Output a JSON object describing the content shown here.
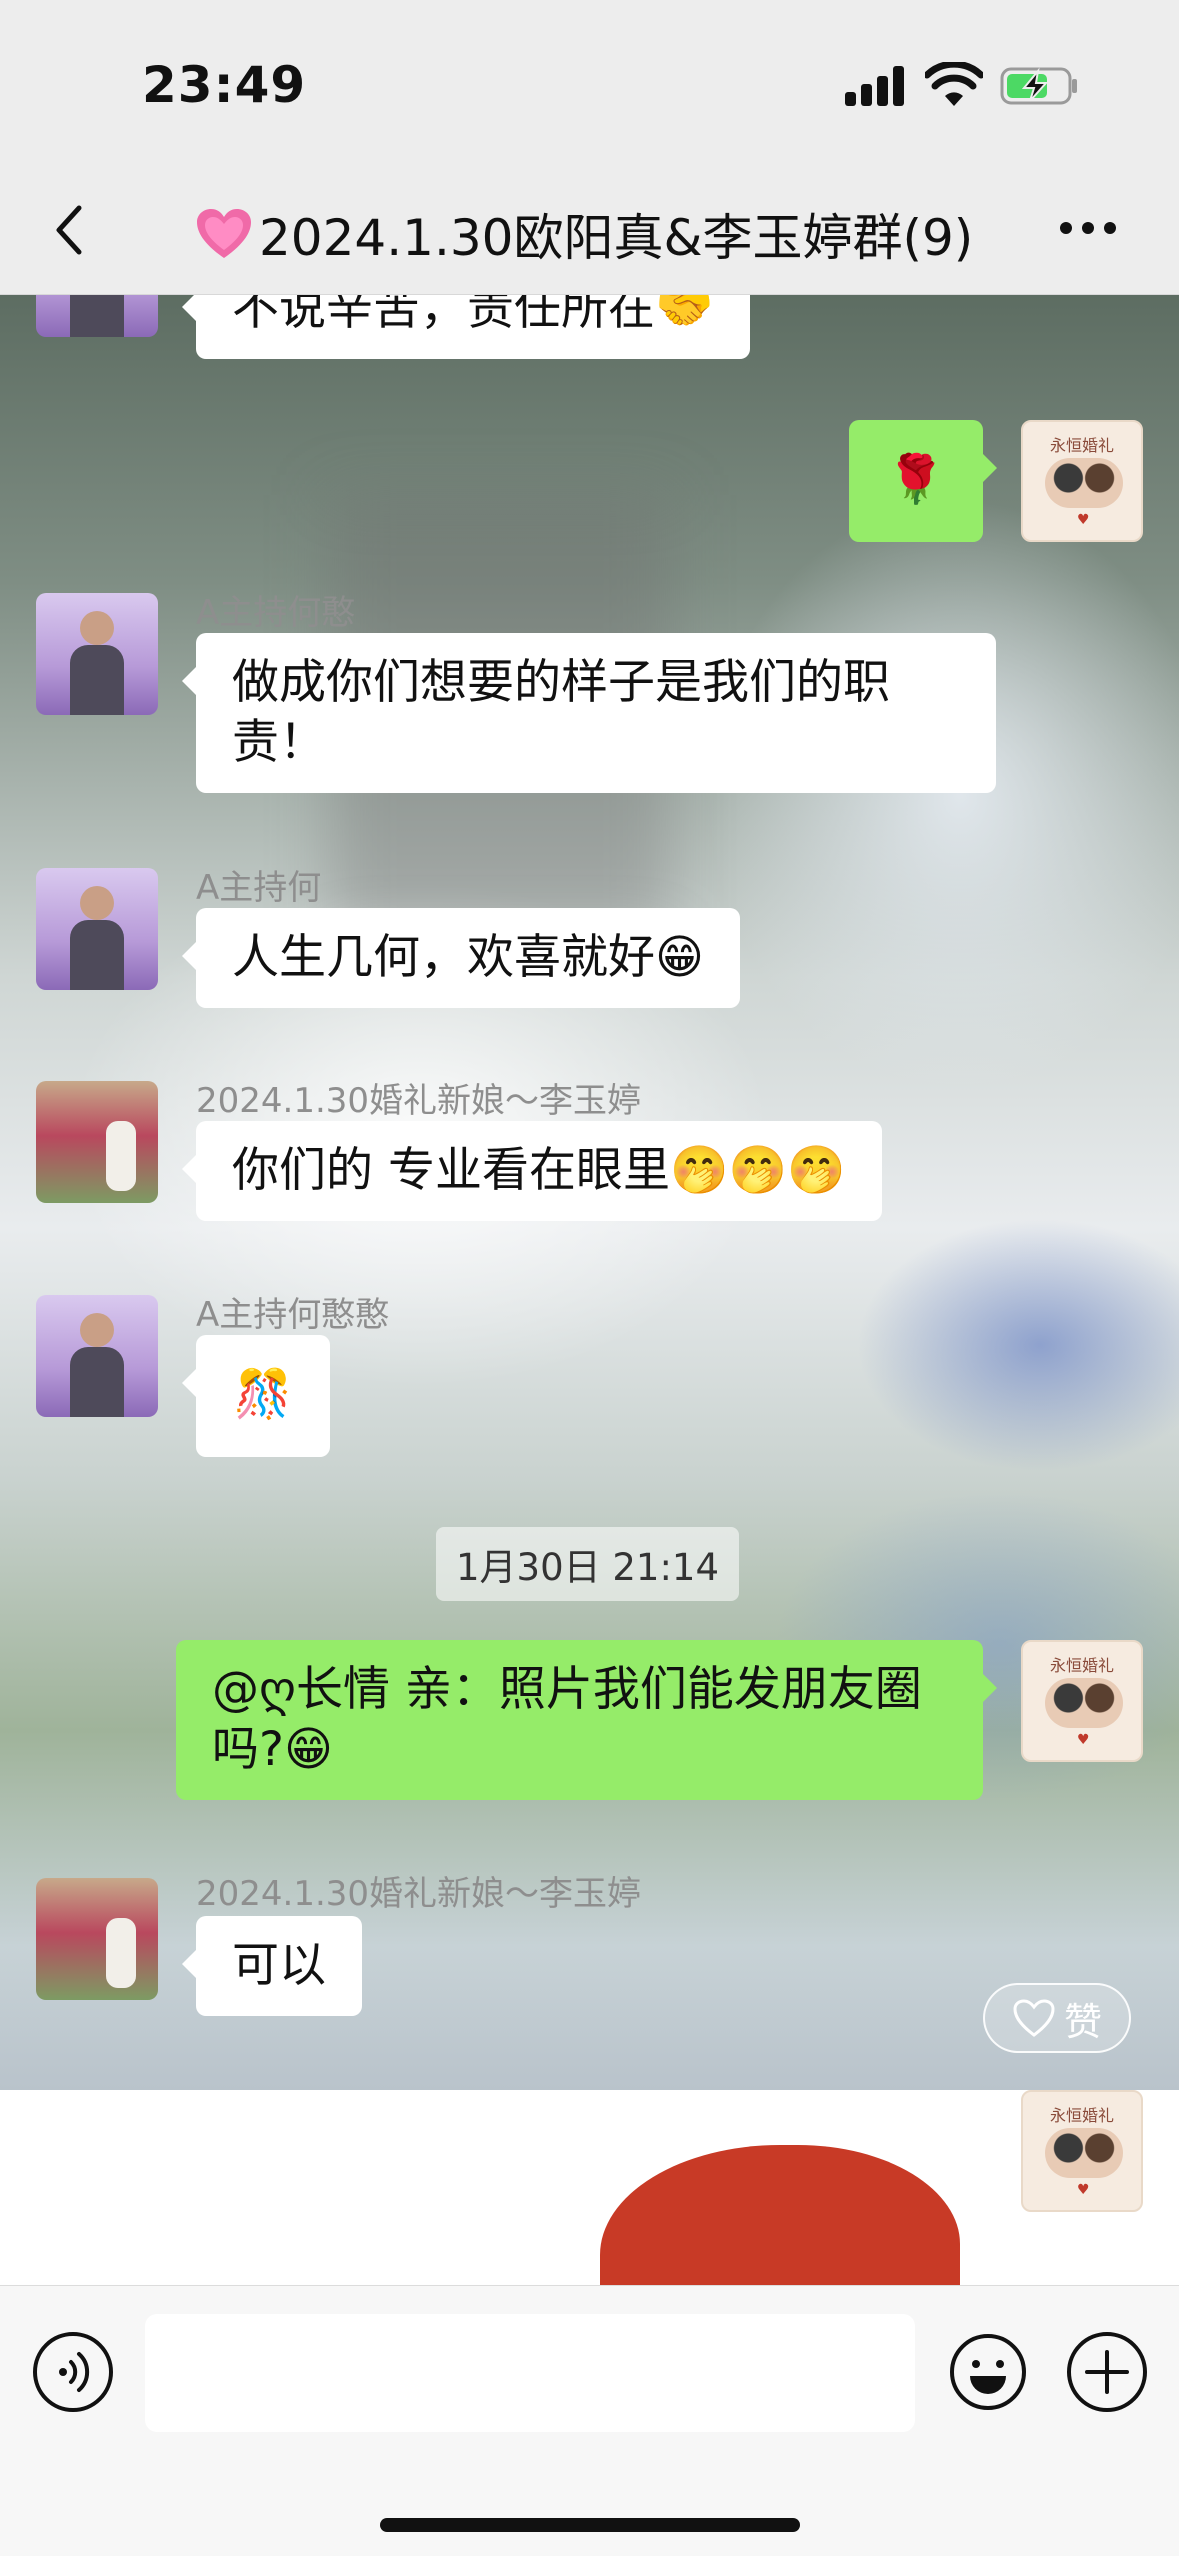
{
  "status_bar": {
    "time": "23:49"
  },
  "header": {
    "title": "2024.1.30欧阳真&李玉婷群(9)"
  },
  "messages": [
    {
      "text": "不说辛苦，责任所在🤝"
    },
    {
      "text": "🌹"
    },
    {
      "sender": "A主持何憨",
      "text": "做成你们想要的样子是我们的职责！"
    },
    {
      "sender": "A主持何",
      "text": "人生几何，欢喜就好😁"
    },
    {
      "sender": "2024.1.30婚礼新娘～李玉婷",
      "text": "你们的 专业看在眼里🤭🤭🤭"
    },
    {
      "sender": "A主持何憨憨",
      "text": "🎊"
    },
    {
      "timestamp": "1月30日 21:14"
    },
    {
      "text": "@ღ长情 亲：照片我们能发朋友圈吗?😁"
    },
    {
      "sender": "2024.1.30婚礼新娘～李玉婷",
      "text": "可以"
    }
  ],
  "like_button": {
    "label": "赞"
  },
  "input_bar": {
    "placeholder": ""
  },
  "avatar_logo_text": "永恒婚礼",
  "colors": {
    "outgoing_bubble": "#95ec69",
    "incoming_bubble": "#ffffff",
    "background": "#ededed"
  },
  "icons": [
    "back-chevron-icon",
    "heart-emoji-icon",
    "more-dots-icon",
    "voice-icon",
    "emoji-icon",
    "plus-icon",
    "signal-icon",
    "wifi-icon",
    "battery-charging-icon"
  ]
}
